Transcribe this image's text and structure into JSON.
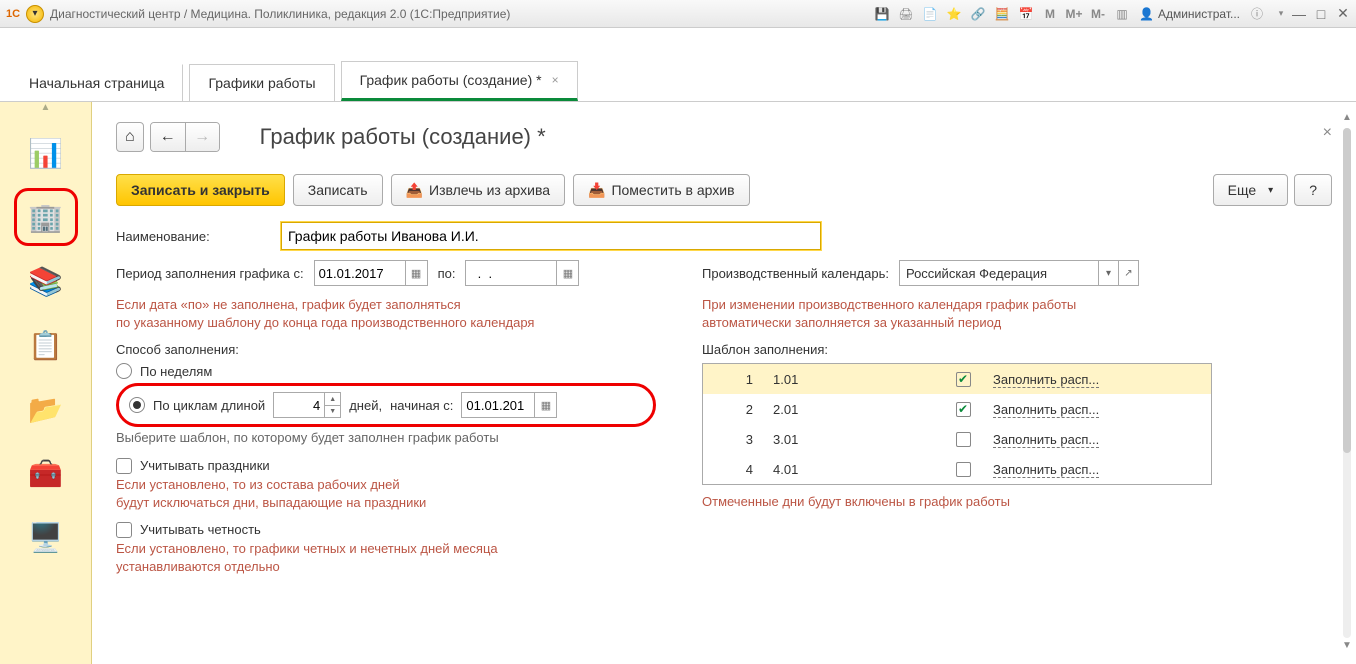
{
  "titlebar": {
    "logo": "1C",
    "title": "Диагностический центр / Медицина. Поликлиника, редакция 2.0  (1С:Предприятие)",
    "m1": "M",
    "m2": "M+",
    "m3": "M-",
    "user": "Администрат..."
  },
  "tabs": {
    "t1": "Начальная страница",
    "t2": "Графики работы",
    "t3": "График работы (создание) *"
  },
  "page": {
    "title": "График работы (создание) *"
  },
  "toolbar": {
    "save_close": "Записать и закрыть",
    "save": "Записать",
    "extract": "Извлечь из архива",
    "archive": "Поместить в архив",
    "more": "Еще",
    "help": "?"
  },
  "form": {
    "name_label": "Наименование:",
    "name_value": "График работы Иванова И.И.",
    "period_from_label": "Период заполнения графика с:",
    "period_from": "01.01.2017",
    "period_to_label": "по:",
    "period_to": "  .  .    ",
    "period_hint1": "Если дата «по» не заполнена, график будет заполняться",
    "period_hint2": "по указанному шаблону до конца года производственного календаря",
    "fill_mode_label": "Способ заполнения:",
    "by_weeks": "По неделям",
    "by_cycles": "По циклам длиной",
    "cycle_len": "4",
    "days_label": "дней,",
    "start_label": "начиная с:",
    "start_date": "01.01.201",
    "template_hint": "Выберите шаблон, по которому будет заполнен график работы",
    "holidays": "Учитывать праздники",
    "holidays_hint1": "Если установлено, то из состава рабочих дней",
    "holidays_hint2": "будут исключаться дни, выпадающие на праздники",
    "parity": "Учитывать четность",
    "parity_hint1": "Если установлено, то графики четных и нечетных дней месяца",
    "parity_hint2": "устанавливаются отдельно",
    "calendar_label": "Производственный календарь:",
    "calendar_value": "Российская Федерация",
    "calendar_hint1": "При изменении производственного календаря график работы",
    "calendar_hint2": "автоматически заполняется за указанный период",
    "template_label": "Шаблон заполнения:",
    "template_footer": "Отмеченные дни будут включены в график работы"
  },
  "template_rows": [
    {
      "n": "1",
      "d": "1.01",
      "chk": true,
      "link": "Заполнить расп..."
    },
    {
      "n": "2",
      "d": "2.01",
      "chk": true,
      "link": "Заполнить расп..."
    },
    {
      "n": "3",
      "d": "3.01",
      "chk": false,
      "link": "Заполнить расп..."
    },
    {
      "n": "4",
      "d": "4.01",
      "chk": false,
      "link": "Заполнить расп..."
    }
  ]
}
